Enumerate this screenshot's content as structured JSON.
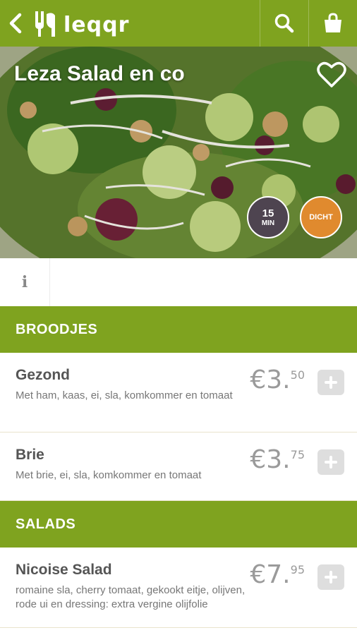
{
  "header": {
    "logo_text": "leqqr"
  },
  "restaurant": {
    "name": "Leza Salad en co",
    "prep_time": "15",
    "prep_unit": "MIN",
    "status": "DICHT"
  },
  "sections": [
    {
      "title": "BROODJES",
      "items": [
        {
          "name": "Gezond",
          "desc": "Met ham, kaas, ei, sla, komkommer en tomaat",
          "price_main": "€3.",
          "price_cents": "50"
        },
        {
          "name": "Brie",
          "desc": "Met brie, ei, sla, komkommer en tomaat",
          "price_main": "€3.",
          "price_cents": "75"
        }
      ]
    },
    {
      "title": "SALADS",
      "items": [
        {
          "name": "Nicoise Salad",
          "desc": "romaine sla, cherry tomaat, gekookt eitje, olijven, rode ui en dressing: extra vergine olijfolie",
          "price_main": "€7.",
          "price_cents": "95"
        }
      ]
    }
  ],
  "info_tab": {
    "icon_glyph": "i"
  },
  "colors": {
    "brand_green": "#7fa31f",
    "time_badge": "#4e4450",
    "status_badge": "#e08a2e"
  }
}
